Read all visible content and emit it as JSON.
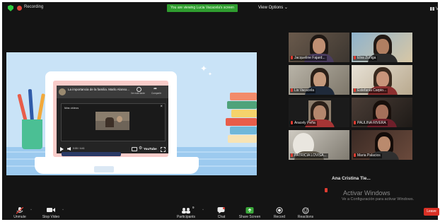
{
  "topbar": {
    "recording_label": "Recording",
    "viewing_banner": "You are viewing Lucia Vacacela's screen",
    "view_options": "View Options ⌄",
    "view_label": "Vi"
  },
  "shared_video": {
    "title": "La importancia de la familia. Marlo Alonso...",
    "watch_later": "Ver más tarde",
    "share": "Compartir",
    "dialog_title": "Más videos",
    "time": "0:00 / 4:41",
    "logo": "YouTube"
  },
  "participants": [
    {
      "name": "Jacqueline Fajard..."
    },
    {
      "name": "Elsa Zuñiga"
    },
    {
      "name": "Lis Vacacela"
    },
    {
      "name": "Estefania Carpio..."
    },
    {
      "name": "Aracely Peña"
    },
    {
      "name": "PAULINA RIVERA"
    },
    {
      "name": "PATRICIA LOVISA..."
    },
    {
      "name": "Maria Palacios"
    }
  ],
  "active_speaker": "Ana Cristina Tie...",
  "watermark": {
    "title": "Activar Windows",
    "subtitle": "Ve a Configuración para activar Windows."
  },
  "toolbar": {
    "unmute": "Unmute",
    "stop_video": "Stop Video",
    "participants": "Participants",
    "participants_count": "9",
    "chat": "Chat",
    "share_screen": "Share Screen",
    "record": "Record",
    "reactions": "Reactions",
    "leave": "Leave"
  },
  "colors": {
    "background": "#141414",
    "banner_green": "#2f9d2f",
    "active_border": "#a8d23a",
    "share_green": "#3aa83a",
    "leave_red": "#d93025",
    "muted_red": "#e03c31"
  },
  "icons": [
    "shield-icon",
    "record-dot-icon",
    "grid-icon",
    "mic-muted-icon",
    "camera-icon",
    "participants-icon",
    "chat-icon",
    "share-screen-icon",
    "record-icon",
    "reactions-icon"
  ]
}
